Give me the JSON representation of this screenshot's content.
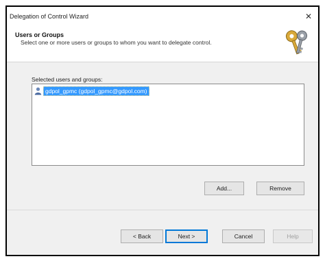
{
  "window": {
    "title": "Delegation of Control Wizard",
    "close_glyph": "✕"
  },
  "header": {
    "title": "Users or Groups",
    "subtitle": "Select one or more users or groups to whom you want to delegate control.",
    "icon": "keys-icon"
  },
  "selection": {
    "label": "Selected users and groups:",
    "items": [
      {
        "text": "gdpol_gpmc (gdpol_gpmc@gdpol.com)",
        "icon": "user-icon",
        "selected": true
      }
    ]
  },
  "list_buttons": {
    "add_label": "Add...",
    "remove_label": "Remove"
  },
  "footer": {
    "back_label": "< Back",
    "next_label": "Next >",
    "cancel_label": "Cancel",
    "help_label": "Help"
  },
  "colors": {
    "selection": "#3399ff",
    "default_button_border": "#0078d7",
    "dialog_background": "#f0f0f0"
  }
}
